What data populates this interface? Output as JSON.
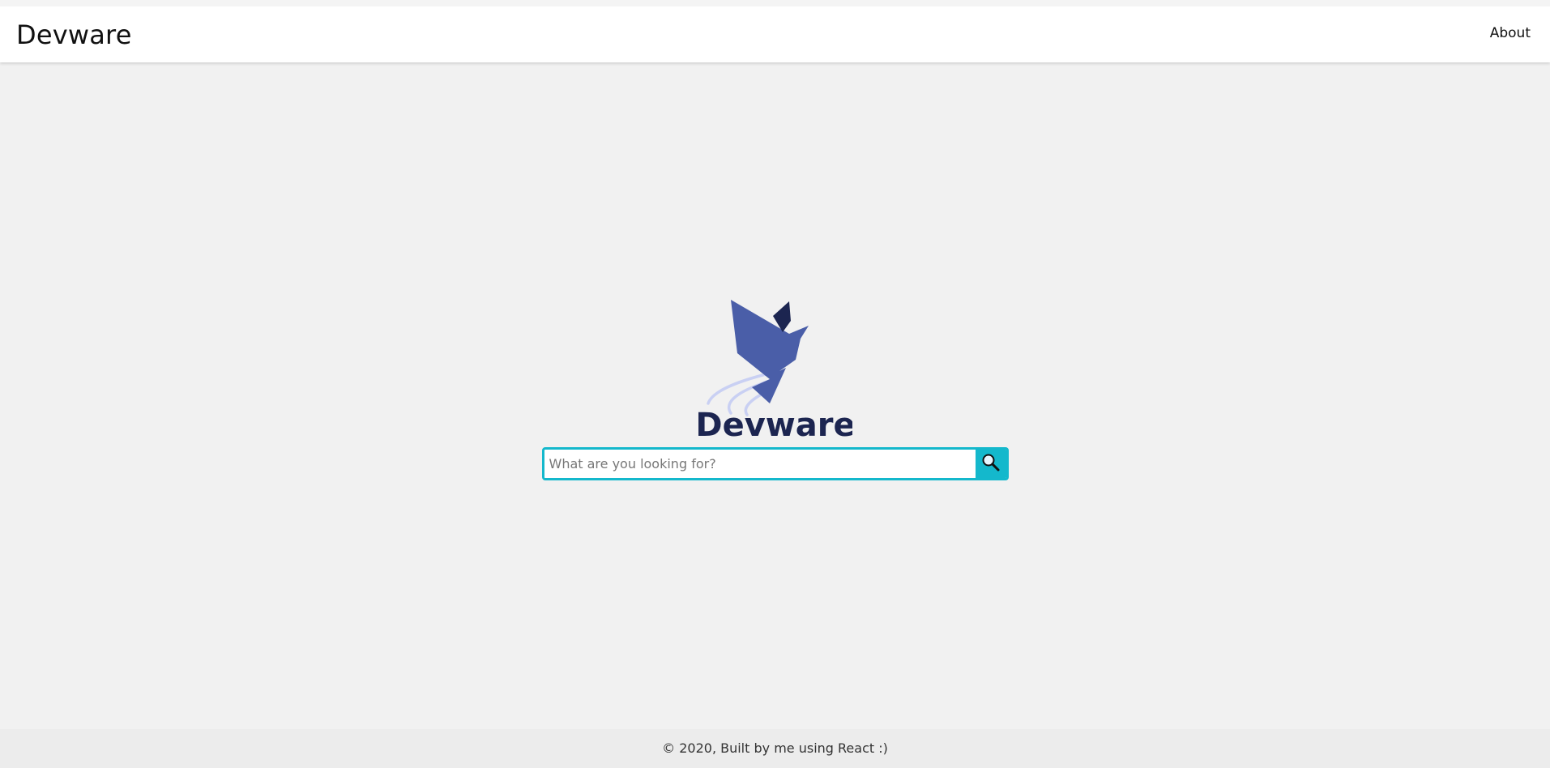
{
  "header": {
    "brand": "Devware",
    "nav": {
      "about_label": "About"
    }
  },
  "hero": {
    "logo_icon": "origami-bird-icon",
    "logo_text": "Devware",
    "colors": {
      "bird_body": "#4a5ea8",
      "bird_wing_dark": "#1c2550",
      "wind_lines": "#c9d0f3",
      "logo_text": "#1c2550"
    }
  },
  "search": {
    "placeholder": "What are you looking for?",
    "value": "",
    "button_icon": "search-icon",
    "accent_color": "#14b8cc"
  },
  "footer": {
    "text": "© 2020, Built by me using React :)"
  }
}
